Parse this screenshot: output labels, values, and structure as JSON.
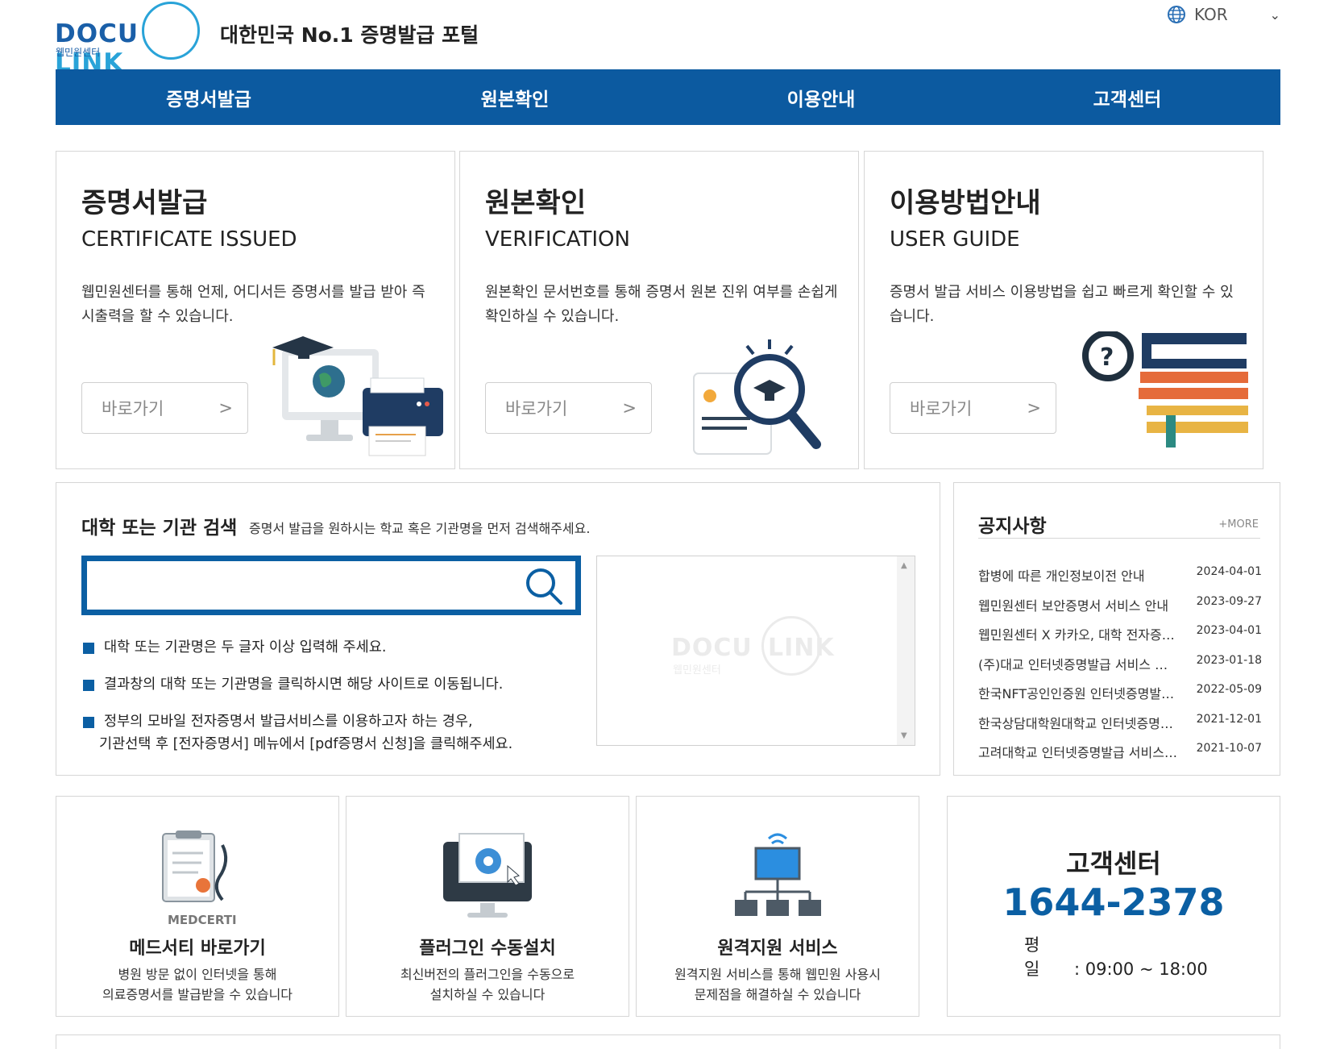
{
  "header": {
    "logo_text_a": "DOCU",
    "logo_text_b": "LINK",
    "logo_sub": "웹민원센터",
    "tagline": "대한민국 No.1 증명발급 포털",
    "language": "KOR"
  },
  "nav": [
    "증명서발급",
    "원본확인",
    "이용안내",
    "고객센터"
  ],
  "cards": [
    {
      "title_ko": "증명서발급",
      "title_en": "CERTIFICATE ISSUED",
      "desc": "웹민원센터를 통해 언제, 어디서든 증명서를 발급 받아 즉시출력을 할 수 있습니다.",
      "button": "바로가기",
      "arrow": ">"
    },
    {
      "title_ko": "원본확인",
      "title_en": "VERIFICATION",
      "desc": "원본확인 문서번호를 통해 증명서 원본 진위 여부를 손쉽게 확인하실 수 있습니다.",
      "button": "바로가기",
      "arrow": ">"
    },
    {
      "title_ko": "이용방법안내",
      "title_en": "USER GUIDE",
      "desc": "증명서 발급 서비스 이용방법을 쉽고 빠르게 확인할 수 있습니다.",
      "button": "바로가기",
      "arrow": ">"
    }
  ],
  "search": {
    "title": "대학 또는 기관 검색",
    "subtitle": "증명서 발급을 원하시는 학교 혹은 기관명을 먼저 검색해주세요.",
    "placeholder": "",
    "notes": [
      "대학 또는 기관명은 두 글자 이상 입력해 주세요.",
      "결과창의 대학 또는 기관명을 클릭하시면 해당 사이트로 이동됩니다.",
      "정부의 모바일 전자증명서 발급서비스를 이용하고자 하는 경우,",
      "기관선택 후 [전자증명서] 메뉴에서 [pdf증명서 신청]을 클릭해주세요."
    ]
  },
  "notice": {
    "title": "공지사항",
    "more": "+MORE",
    "items": [
      {
        "title": "합병에 따른 개인정보이전 안내",
        "date": "2024-04-01"
      },
      {
        "title": "웹민원센터 보안증명서 서비스 안내",
        "date": "2023-09-27"
      },
      {
        "title": "웹민원센터 X 카카오, 대학 전자증명서",
        "date": "2023-04-01"
      },
      {
        "title": "(주)대교 인터넷증명발급 서비스 안내",
        "date": "2023-01-18"
      },
      {
        "title": "한국NFT공인인증원 인터넷증명발급 안내",
        "date": "2022-05-09"
      },
      {
        "title": "한국상담대학원대학교 인터넷증명발급",
        "date": "2021-12-01"
      },
      {
        "title": "고려대학교 인터넷증명발급 서비스 안내",
        "date": "2021-10-07"
      }
    ]
  },
  "bottom": [
    {
      "logo": "MEDCERTI",
      "title": "메드서티 바로가기",
      "desc1": "병원 방문 없이 인터넷을 통해",
      "desc2": "의료증명서를 발급받을 수 있습니다",
      "icon": "medical-clipboard-icon"
    },
    {
      "title": "플러그인 수동설치",
      "desc1": "최신버전의 플러그인을 수동으로",
      "desc2": "설치하실 수 있습니다",
      "icon": "plugin-gear-icon"
    },
    {
      "title": "원격지원 서비스",
      "desc1": "원격지원 서비스를 통해 웹민원 사용시",
      "desc2": "문제점을 해결하실 수 있습니다",
      "icon": "remote-network-icon"
    }
  ],
  "support": {
    "title": "고객센터",
    "phone": "1644-2378",
    "hours_label": "평　　일",
    "hours": ": 09:00 ~ 18:00"
  },
  "colors": {
    "primary": "#0c5aa0",
    "accent": "#29a3d8"
  }
}
